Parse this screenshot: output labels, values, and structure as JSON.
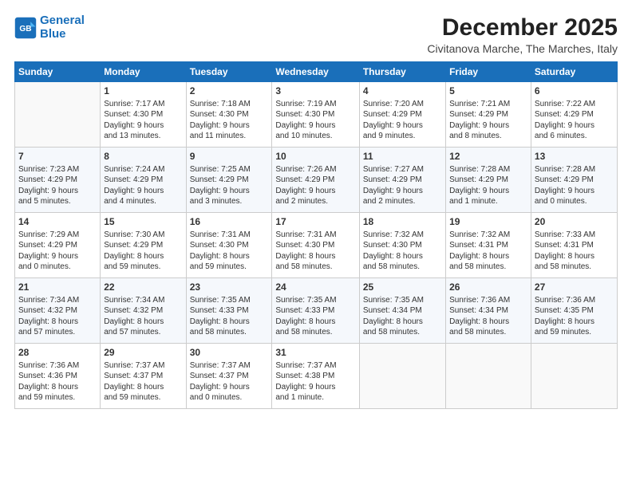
{
  "logo": {
    "line1": "General",
    "line2": "Blue"
  },
  "header": {
    "month": "December 2025",
    "location": "Civitanova Marche, The Marches, Italy"
  },
  "columns": [
    "Sunday",
    "Monday",
    "Tuesday",
    "Wednesday",
    "Thursday",
    "Friday",
    "Saturday"
  ],
  "weeks": [
    [
      {
        "day": "",
        "info": ""
      },
      {
        "day": "1",
        "info": "Sunrise: 7:17 AM\nSunset: 4:30 PM\nDaylight: 9 hours\nand 13 minutes."
      },
      {
        "day": "2",
        "info": "Sunrise: 7:18 AM\nSunset: 4:30 PM\nDaylight: 9 hours\nand 11 minutes."
      },
      {
        "day": "3",
        "info": "Sunrise: 7:19 AM\nSunset: 4:30 PM\nDaylight: 9 hours\nand 10 minutes."
      },
      {
        "day": "4",
        "info": "Sunrise: 7:20 AM\nSunset: 4:29 PM\nDaylight: 9 hours\nand 9 minutes."
      },
      {
        "day": "5",
        "info": "Sunrise: 7:21 AM\nSunset: 4:29 PM\nDaylight: 9 hours\nand 8 minutes."
      },
      {
        "day": "6",
        "info": "Sunrise: 7:22 AM\nSunset: 4:29 PM\nDaylight: 9 hours\nand 6 minutes."
      }
    ],
    [
      {
        "day": "7",
        "info": "Sunrise: 7:23 AM\nSunset: 4:29 PM\nDaylight: 9 hours\nand 5 minutes."
      },
      {
        "day": "8",
        "info": "Sunrise: 7:24 AM\nSunset: 4:29 PM\nDaylight: 9 hours\nand 4 minutes."
      },
      {
        "day": "9",
        "info": "Sunrise: 7:25 AM\nSunset: 4:29 PM\nDaylight: 9 hours\nand 3 minutes."
      },
      {
        "day": "10",
        "info": "Sunrise: 7:26 AM\nSunset: 4:29 PM\nDaylight: 9 hours\nand 2 minutes."
      },
      {
        "day": "11",
        "info": "Sunrise: 7:27 AM\nSunset: 4:29 PM\nDaylight: 9 hours\nand 2 minutes."
      },
      {
        "day": "12",
        "info": "Sunrise: 7:28 AM\nSunset: 4:29 PM\nDaylight: 9 hours\nand 1 minute."
      },
      {
        "day": "13",
        "info": "Sunrise: 7:28 AM\nSunset: 4:29 PM\nDaylight: 9 hours\nand 0 minutes."
      }
    ],
    [
      {
        "day": "14",
        "info": "Sunrise: 7:29 AM\nSunset: 4:29 PM\nDaylight: 9 hours\nand 0 minutes."
      },
      {
        "day": "15",
        "info": "Sunrise: 7:30 AM\nSunset: 4:29 PM\nDaylight: 8 hours\nand 59 minutes."
      },
      {
        "day": "16",
        "info": "Sunrise: 7:31 AM\nSunset: 4:30 PM\nDaylight: 8 hours\nand 59 minutes."
      },
      {
        "day": "17",
        "info": "Sunrise: 7:31 AM\nSunset: 4:30 PM\nDaylight: 8 hours\nand 58 minutes."
      },
      {
        "day": "18",
        "info": "Sunrise: 7:32 AM\nSunset: 4:30 PM\nDaylight: 8 hours\nand 58 minutes."
      },
      {
        "day": "19",
        "info": "Sunrise: 7:32 AM\nSunset: 4:31 PM\nDaylight: 8 hours\nand 58 minutes."
      },
      {
        "day": "20",
        "info": "Sunrise: 7:33 AM\nSunset: 4:31 PM\nDaylight: 8 hours\nand 58 minutes."
      }
    ],
    [
      {
        "day": "21",
        "info": "Sunrise: 7:34 AM\nSunset: 4:32 PM\nDaylight: 8 hours\nand 57 minutes."
      },
      {
        "day": "22",
        "info": "Sunrise: 7:34 AM\nSunset: 4:32 PM\nDaylight: 8 hours\nand 57 minutes."
      },
      {
        "day": "23",
        "info": "Sunrise: 7:35 AM\nSunset: 4:33 PM\nDaylight: 8 hours\nand 58 minutes."
      },
      {
        "day": "24",
        "info": "Sunrise: 7:35 AM\nSunset: 4:33 PM\nDaylight: 8 hours\nand 58 minutes."
      },
      {
        "day": "25",
        "info": "Sunrise: 7:35 AM\nSunset: 4:34 PM\nDaylight: 8 hours\nand 58 minutes."
      },
      {
        "day": "26",
        "info": "Sunrise: 7:36 AM\nSunset: 4:34 PM\nDaylight: 8 hours\nand 58 minutes."
      },
      {
        "day": "27",
        "info": "Sunrise: 7:36 AM\nSunset: 4:35 PM\nDaylight: 8 hours\nand 59 minutes."
      }
    ],
    [
      {
        "day": "28",
        "info": "Sunrise: 7:36 AM\nSunset: 4:36 PM\nDaylight: 8 hours\nand 59 minutes."
      },
      {
        "day": "29",
        "info": "Sunrise: 7:37 AM\nSunset: 4:37 PM\nDaylight: 8 hours\nand 59 minutes."
      },
      {
        "day": "30",
        "info": "Sunrise: 7:37 AM\nSunset: 4:37 PM\nDaylight: 9 hours\nand 0 minutes."
      },
      {
        "day": "31",
        "info": "Sunrise: 7:37 AM\nSunset: 4:38 PM\nDaylight: 9 hours\nand 1 minute."
      },
      {
        "day": "",
        "info": ""
      },
      {
        "day": "",
        "info": ""
      },
      {
        "day": "",
        "info": ""
      }
    ]
  ]
}
